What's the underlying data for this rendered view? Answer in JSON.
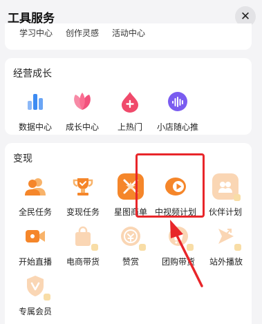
{
  "header": {
    "title": "工具服务",
    "close_glyph": "✕"
  },
  "top_row": {
    "labels": [
      "学习中心",
      "创作灵感",
      "活动中心"
    ]
  },
  "growth": {
    "title": "经营成长",
    "items": [
      {
        "label": "数据中心",
        "icon": "bar-chart-icon",
        "color": "#3d8bf2"
      },
      {
        "label": "成长中心",
        "icon": "flower-icon",
        "color": "#f2527d"
      },
      {
        "label": "上热门",
        "icon": "fire-drop-icon",
        "color": "#f04a6b"
      },
      {
        "label": "小店随心推",
        "icon": "sound-wave-icon",
        "color": "#7a5cf0"
      }
    ]
  },
  "monetize": {
    "title": "变现",
    "items": [
      {
        "label": "全民任务",
        "icon": "people-icon",
        "color": "#f5862a",
        "faded": false
      },
      {
        "label": "变现任务",
        "icon": "trophy-icon",
        "color": "#f5862a",
        "faded": false
      },
      {
        "label": "星图商单",
        "icon": "star-map-icon",
        "color": "#f5862a",
        "faded": false
      },
      {
        "label": "中视频计划",
        "icon": "play-icon",
        "color": "#f5862a",
        "faded": false
      },
      {
        "label": "伙伴计划",
        "icon": "partner-icon",
        "color": "#f5a55a",
        "faded": true
      },
      {
        "label": "开始直播",
        "icon": "camera-icon",
        "color": "#f5862a",
        "faded": false
      },
      {
        "label": "电商带货",
        "icon": "shopping-bag-icon",
        "color": "#f5a55a",
        "faded": true
      },
      {
        "label": "赞赏",
        "icon": "reward-icon",
        "color": "#f5a55a",
        "faded": true
      },
      {
        "label": "团购带货",
        "icon": "group-buy-icon",
        "color": "#f5a55a",
        "faded": true
      },
      {
        "label": "站外播放",
        "icon": "external-play-icon",
        "color": "#f5a55a",
        "faded": true
      },
      {
        "label": "专属会员",
        "icon": "vip-icon",
        "color": "#f5a55a",
        "faded": true
      }
    ]
  },
  "annotation": {
    "highlight_color": "#e8262a"
  }
}
